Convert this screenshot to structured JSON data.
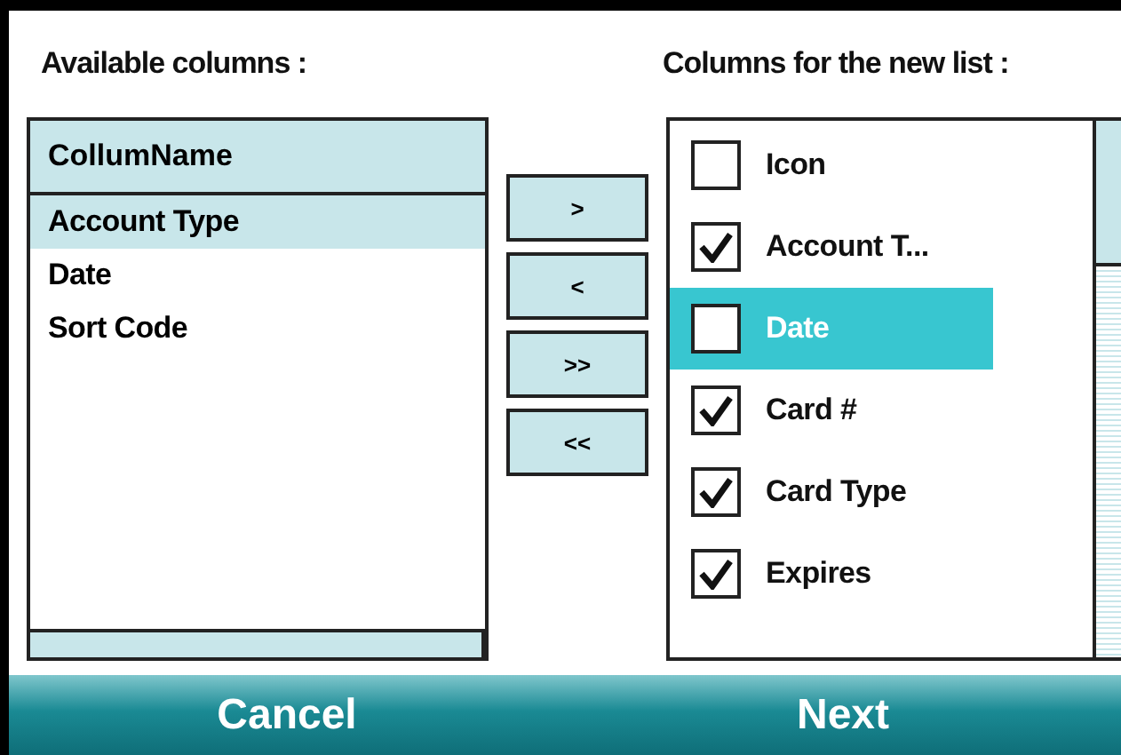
{
  "available": {
    "label": "Available columns :",
    "header": "CollumName",
    "items": [
      {
        "label": "Account Type",
        "selected": true
      },
      {
        "label": "Date",
        "selected": false
      },
      {
        "label": "Sort Code",
        "selected": false
      }
    ]
  },
  "move_buttons": [
    ">",
    "<",
    ">>",
    "<<"
  ],
  "new_list": {
    "label": "Columns for the new list :",
    "items": [
      {
        "label": "Icon",
        "checked": false,
        "selected": false
      },
      {
        "label": "Account T...",
        "checked": true,
        "selected": false
      },
      {
        "label": "Date",
        "checked": false,
        "selected": true
      },
      {
        "label": "Card #",
        "checked": true,
        "selected": false
      },
      {
        "label": "Card Type",
        "checked": true,
        "selected": false
      },
      {
        "label": "Expires",
        "checked": true,
        "selected": false
      }
    ]
  },
  "softkeys": [
    "Cancel",
    "Next"
  ]
}
